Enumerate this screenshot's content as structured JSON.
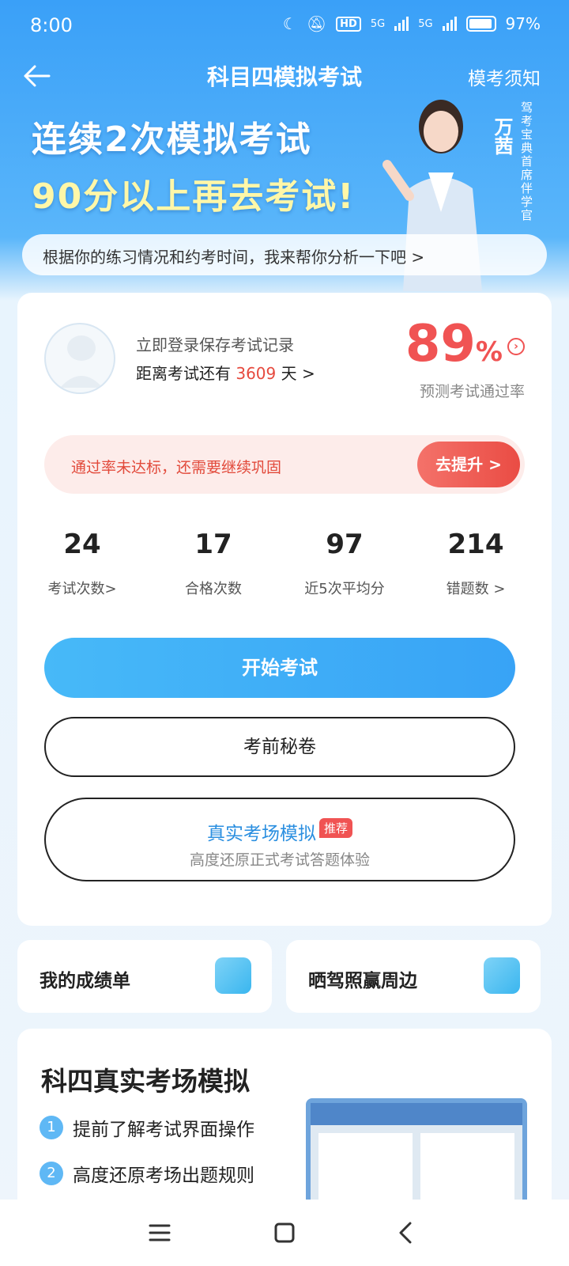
{
  "status": {
    "time": "8:00",
    "hd": "HD",
    "net1": "5G",
    "net2": "5G",
    "battery": "97%"
  },
  "header": {
    "title": "科目四模拟考试",
    "notice": "模考须知"
  },
  "banner": {
    "line1": "连续2次模拟考试",
    "line2": "90分以上再去考试!",
    "coach_name": "万茜",
    "coach_title": "驾考宝典首席伴学官",
    "analysis": "根据你的练习情况和约考时间，我来帮你分析一下吧 >"
  },
  "card": {
    "login": "立即登录保存考试记录",
    "days_prefix": "距离考试还有",
    "days_value": "3609",
    "days_suffix": "天 >",
    "pass_rate_value": "89",
    "pass_rate_unit": "%",
    "pass_rate_label": "预测考试通过率",
    "warning": "通过率未达标，还需要继续巩固",
    "improve_btn": "去提升 >",
    "stats": [
      {
        "value": "24",
        "label": "考试次数>"
      },
      {
        "value": "17",
        "label": "合格次数"
      },
      {
        "value": "97",
        "label": "近5次平均分"
      },
      {
        "value": "214",
        "label": "错题数 >"
      }
    ],
    "start_btn": "开始考试",
    "secret_btn": "考前秘卷",
    "sim_title": "真实考场模拟",
    "sim_badge": "推荐",
    "sim_sub": "高度还原正式考试答题体验"
  },
  "mini": {
    "left": "我的成绩单",
    "right": "晒驾照赢周边"
  },
  "bottom": {
    "title": "科四真实考场模拟",
    "items": [
      {
        "num": "1",
        "text": "提前了解考试界面操作"
      },
      {
        "num": "2",
        "text": "高度还原考场出题规则"
      }
    ]
  }
}
